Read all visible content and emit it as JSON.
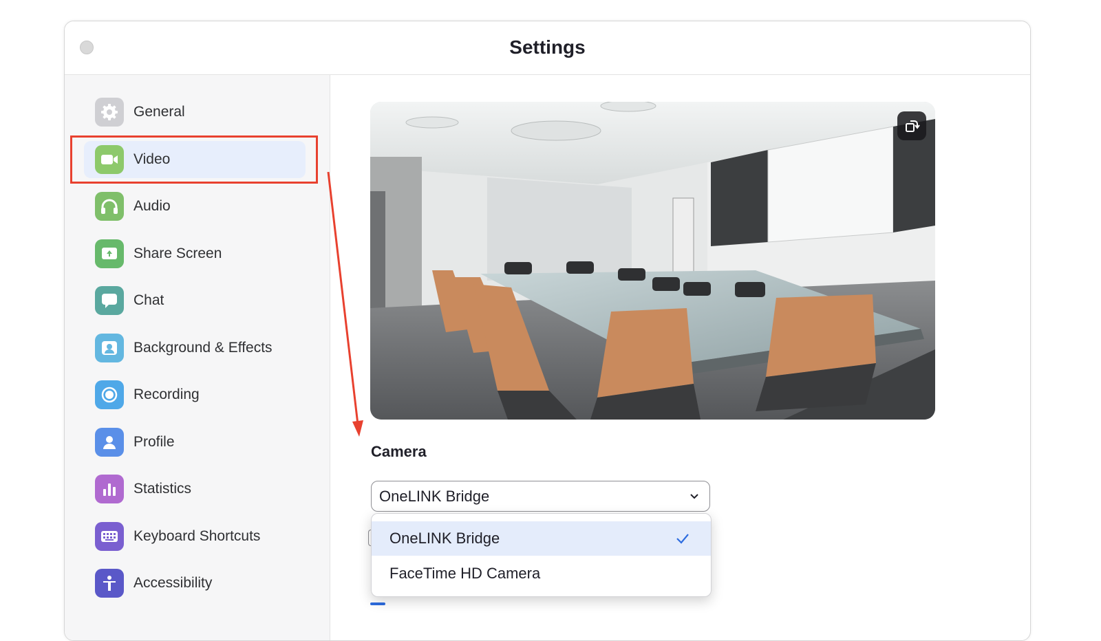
{
  "window": {
    "title": "Settings"
  },
  "sidebar": {
    "items": [
      {
        "label": "General",
        "icon": "gear-icon",
        "color": "#c9c9cd"
      },
      {
        "label": "Video",
        "icon": "video-camera-icon",
        "color": "#8dc96b",
        "selected": true
      },
      {
        "label": "Audio",
        "icon": "headphones-icon",
        "color": "#7fbf6a"
      },
      {
        "label": "Share Screen",
        "icon": "share-screen-icon",
        "color": "#67b96b"
      },
      {
        "label": "Chat",
        "icon": "chat-bubble-icon",
        "color": "#5aa89f"
      },
      {
        "label": "Background & Effects",
        "icon": "person-background-icon",
        "color": "#63b7e0"
      },
      {
        "label": "Recording",
        "icon": "record-icon",
        "color": "#4fa8e8"
      },
      {
        "label": "Profile",
        "icon": "user-icon",
        "color": "#5a8fe8"
      },
      {
        "label": "Statistics",
        "icon": "bar-chart-icon",
        "color": "#b06ad0"
      },
      {
        "label": "Keyboard Shortcuts",
        "icon": "keyboard-icon",
        "color": "#7a5fd0"
      },
      {
        "label": "Accessibility",
        "icon": "accessibility-icon",
        "color": "#5a58c8"
      }
    ]
  },
  "main": {
    "camera_label": "Camera",
    "camera_select": {
      "value": "OneLINK Bridge"
    },
    "camera_options": [
      {
        "label": "OneLINK Bridge",
        "selected": true
      },
      {
        "label": "FaceTime HD Camera",
        "selected": false
      }
    ]
  },
  "colors": {
    "annotation": "#e8412f",
    "selected_bg": "#e7eefc",
    "check": "#2d6cdf"
  }
}
